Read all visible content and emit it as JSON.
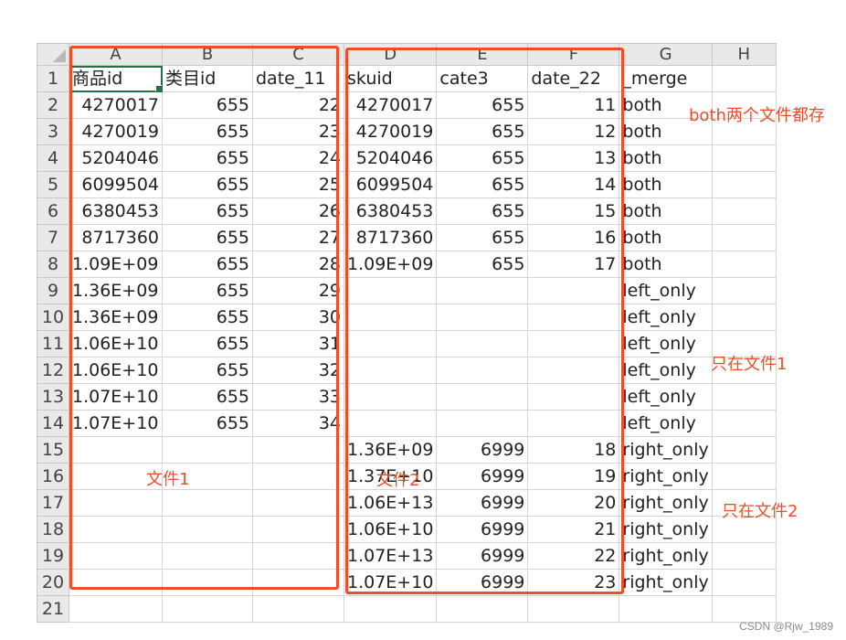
{
  "columns": [
    "A",
    "B",
    "C",
    "D",
    "E",
    "F",
    "G",
    "H"
  ],
  "rows": [
    [
      "商品id",
      "类目id",
      "date_11",
      "skuid",
      "cate3",
      "date_22",
      "_merge",
      ""
    ],
    [
      "4270017",
      "655",
      "22",
      "4270017",
      "655",
      "11",
      "both",
      ""
    ],
    [
      "4270019",
      "655",
      "23",
      "4270019",
      "655",
      "12",
      "both",
      ""
    ],
    [
      "5204046",
      "655",
      "24",
      "5204046",
      "655",
      "13",
      "both",
      ""
    ],
    [
      "6099504",
      "655",
      "25",
      "6099504",
      "655",
      "14",
      "both",
      ""
    ],
    [
      "6380453",
      "655",
      "26",
      "6380453",
      "655",
      "15",
      "both",
      ""
    ],
    [
      "8717360",
      "655",
      "27",
      "8717360",
      "655",
      "16",
      "both",
      ""
    ],
    [
      "1.09E+09",
      "655",
      "28",
      "1.09E+09",
      "655",
      "17",
      "both",
      ""
    ],
    [
      "1.36E+09",
      "655",
      "29",
      "",
      "",
      "",
      "left_only",
      ""
    ],
    [
      "1.36E+09",
      "655",
      "30",
      "",
      "",
      "",
      "left_only",
      ""
    ],
    [
      "1.06E+10",
      "655",
      "31",
      "",
      "",
      "",
      "left_only",
      ""
    ],
    [
      "1.06E+10",
      "655",
      "32",
      "",
      "",
      "",
      "left_only",
      ""
    ],
    [
      "1.07E+10",
      "655",
      "33",
      "",
      "",
      "",
      "left_only",
      ""
    ],
    [
      "1.07E+10",
      "655",
      "34",
      "",
      "",
      "",
      "left_only",
      ""
    ],
    [
      "",
      "",
      "",
      "1.36E+09",
      "6999",
      "18",
      "right_only",
      ""
    ],
    [
      "",
      "",
      "",
      "1.37E+10",
      "6999",
      "19",
      "right_only",
      ""
    ],
    [
      "",
      "",
      "",
      "1.06E+13",
      "6999",
      "20",
      "right_only",
      ""
    ],
    [
      "",
      "",
      "",
      "1.06E+10",
      "6999",
      "21",
      "right_only",
      ""
    ],
    [
      "",
      "",
      "",
      "1.07E+13",
      "6999",
      "22",
      "right_only",
      ""
    ],
    [
      "",
      "",
      "",
      "1.07E+10",
      "6999",
      "23",
      "right_only",
      ""
    ],
    [
      "",
      "",
      "",
      "",
      "",
      "",
      "",
      ""
    ]
  ],
  "annotations": {
    "both": "both两个文件都存",
    "left_only": "只在文件1",
    "right_only": "只在文件2",
    "file1": "文件1",
    "file2": "文件2"
  },
  "accent_color": "#e8502c",
  "watermark": "CSDN @Rjw_1989"
}
